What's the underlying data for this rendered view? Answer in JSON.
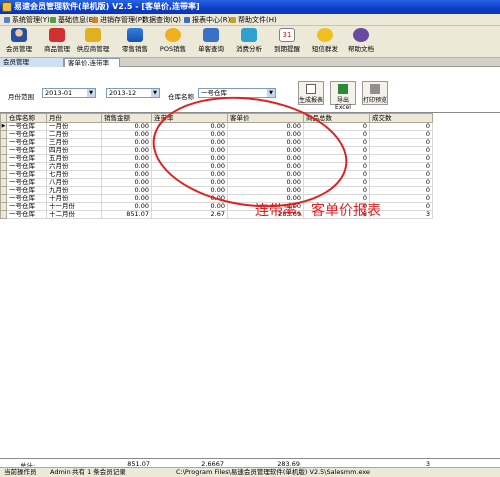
{
  "window": {
    "title": "易速会员管理软件(单机版) V2.5 - [客单价,连带率]"
  },
  "menu": [
    "系统管理(Y)",
    "基础信息(B)",
    "进销存管理(P)",
    "数据查询(Q)",
    "报表中心(R)",
    "帮助文件(H)"
  ],
  "toolbar": [
    "会员管理",
    "商品管理",
    "供应商管理",
    "零售销售",
    "POS销售",
    "单客查询",
    "消费分析",
    "到期提醒",
    "短信群发",
    "帮助文档"
  ],
  "tabs": [
    "会员管理",
    "客单价,连带率"
  ],
  "filter": {
    "range_label": "月份范围",
    "from": "2013-01",
    "to": "2013-12",
    "store_label": "仓库名称",
    "store": "一号仓库",
    "btn_generate": "生成报表",
    "btn_export": "导出Excel",
    "btn_print": "打印预览"
  },
  "table": {
    "headers": [
      "仓库名称",
      "月份",
      "销售金额",
      "连带率",
      "客单价",
      "商品总数",
      "成交数"
    ],
    "rows": [
      [
        "一号仓库",
        "一月份",
        "0.00",
        "0.00",
        "0.00",
        "0",
        "0"
      ],
      [
        "一号仓库",
        "二月份",
        "0.00",
        "0.00",
        "0.00",
        "0",
        "0"
      ],
      [
        "一号仓库",
        "三月份",
        "0.00",
        "0.00",
        "0.00",
        "0",
        "0"
      ],
      [
        "一号仓库",
        "四月份",
        "0.00",
        "0.00",
        "0.00",
        "0",
        "0"
      ],
      [
        "一号仓库",
        "五月份",
        "0.00",
        "0.00",
        "0.00",
        "0",
        "0"
      ],
      [
        "一号仓库",
        "六月份",
        "0.00",
        "0.00",
        "0.00",
        "0",
        "0"
      ],
      [
        "一号仓库",
        "七月份",
        "0.00",
        "0.00",
        "0.00",
        "0",
        "0"
      ],
      [
        "一号仓库",
        "八月份",
        "0.00",
        "0.00",
        "0.00",
        "0",
        "0"
      ],
      [
        "一号仓库",
        "九月份",
        "0.00",
        "0.00",
        "0.00",
        "0",
        "0"
      ],
      [
        "一号仓库",
        "十月份",
        "0.00",
        "0.00",
        "0.00",
        "0",
        "0"
      ],
      [
        "一号仓库",
        "十一月份",
        "0.00",
        "0.00",
        "0.00",
        "0",
        "0"
      ],
      [
        "一号仓库",
        "十二月份",
        "851.07",
        "2.67",
        "283.69",
        "8",
        "3"
      ]
    ]
  },
  "totals": {
    "label": "总计:",
    "sales": "851.07",
    "rate": "2.6667",
    "price": "283.69",
    "count": "3"
  },
  "annotation": "连带率、客单价报表",
  "status": {
    "operator_label": "当前操作员",
    "operator": "Admin",
    "records": "共有 1 条会员记录",
    "path": "C:\\Program Files\\易速会员管理软件(单机版) V2.5\\Salesmm.exe"
  },
  "colors": {
    "accent": "#e02020",
    "titlebar": "#0a3ec8"
  }
}
